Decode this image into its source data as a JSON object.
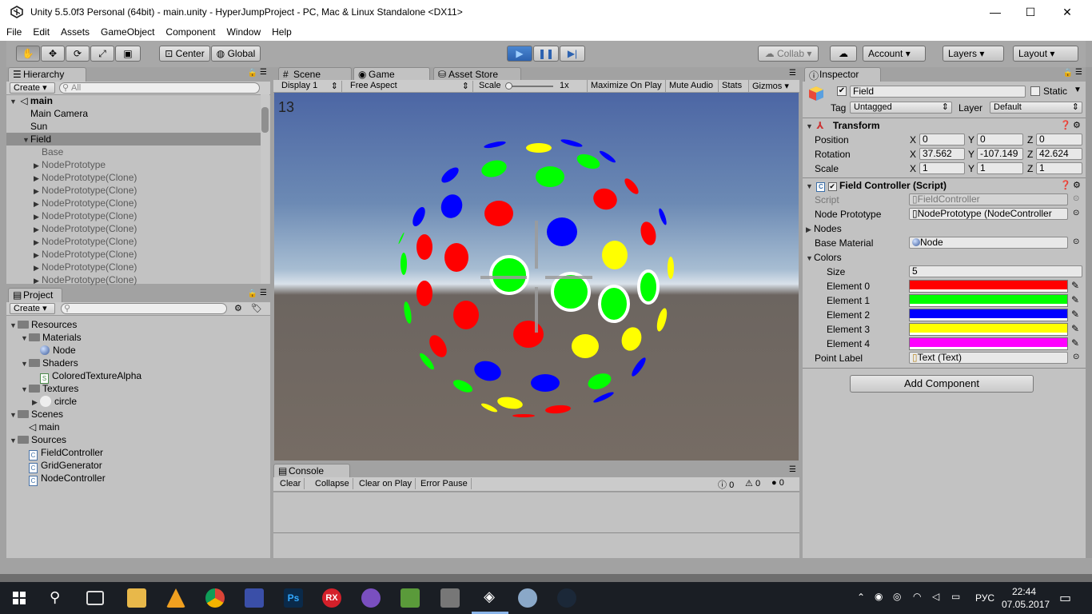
{
  "window": {
    "title": "Unity 5.5.0f3 Personal (64bit) - main.unity - HyperJumpProject - PC, Mac & Linux Standalone <DX11>",
    "minimize": "—",
    "maximize": "☐",
    "close": "✕"
  },
  "menu": [
    "File",
    "Edit",
    "Assets",
    "GameObject",
    "Component",
    "Window",
    "Help"
  ],
  "toolbar": {
    "tools": [
      "hand-icon",
      "move-icon",
      "rotate-icon",
      "scale-icon",
      "rect-icon"
    ],
    "pivot": "Center",
    "space": "Global",
    "collab": "Collab",
    "account": "Account",
    "layers": "Layers",
    "layout": "Layout"
  },
  "hierarchy": {
    "tab": "Hierarchy",
    "create": "Create",
    "search_placeholder": "All",
    "scene": "main",
    "items": [
      {
        "label": "Main Camera",
        "depth": 1
      },
      {
        "label": "Sun",
        "depth": 1
      },
      {
        "label": "Field",
        "depth": 1,
        "selected": true,
        "expanded": true
      },
      {
        "label": "Base",
        "depth": 2
      },
      {
        "label": "NodePrototype",
        "depth": 2,
        "expander": true
      },
      {
        "label": "NodePrototype(Clone)",
        "depth": 2,
        "expander": true
      },
      {
        "label": "NodePrototype(Clone)",
        "depth": 2,
        "expander": true
      },
      {
        "label": "NodePrototype(Clone)",
        "depth": 2,
        "expander": true
      },
      {
        "label": "NodePrototype(Clone)",
        "depth": 2,
        "expander": true
      },
      {
        "label": "NodePrototype(Clone)",
        "depth": 2,
        "expander": true
      },
      {
        "label": "NodePrototype(Clone)",
        "depth": 2,
        "expander": true
      },
      {
        "label": "NodePrototype(Clone)",
        "depth": 2,
        "expander": true
      },
      {
        "label": "NodePrototype(Clone)",
        "depth": 2,
        "expander": true
      },
      {
        "label": "NodePrototype(Clone)",
        "depth": 2,
        "expander": true
      }
    ]
  },
  "project": {
    "tab": "Project",
    "create": "Create",
    "tree": [
      {
        "label": "Resources",
        "depth": 0,
        "type": "folder"
      },
      {
        "label": "Materials",
        "depth": 1,
        "type": "folder"
      },
      {
        "label": "Node",
        "depth": 2,
        "type": "material"
      },
      {
        "label": "Shaders",
        "depth": 1,
        "type": "folder"
      },
      {
        "label": "ColoredTextureAlpha",
        "depth": 2,
        "type": "shader"
      },
      {
        "label": "Textures",
        "depth": 1,
        "type": "folder"
      },
      {
        "label": "circle",
        "depth": 2,
        "type": "texture"
      },
      {
        "label": "Scenes",
        "depth": 0,
        "type": "folder"
      },
      {
        "label": "main",
        "depth": 1,
        "type": "scene"
      },
      {
        "label": "Sources",
        "depth": 0,
        "type": "folder"
      },
      {
        "label": "FieldController",
        "depth": 1,
        "type": "script"
      },
      {
        "label": "GridGenerator",
        "depth": 1,
        "type": "script"
      },
      {
        "label": "NodeController",
        "depth": 1,
        "type": "script"
      }
    ]
  },
  "center_tabs": [
    "Scene",
    "Game",
    "Asset Store"
  ],
  "game_toolbar": {
    "display": "Display 1",
    "aspect": "Free Aspect",
    "scale_label": "Scale",
    "scale_value": "1x",
    "maximize": "Maximize On Play",
    "mute": "Mute Audio",
    "stats": "Stats",
    "gizmos": "Gizmos"
  },
  "game": {
    "score": "13"
  },
  "console": {
    "tab": "Console",
    "buttons": [
      "Clear",
      "Collapse",
      "Clear on Play",
      "Error Pause"
    ],
    "info_count": "0",
    "warning_count": "0",
    "error_count": "0"
  },
  "inspector": {
    "tab": "Inspector",
    "object_name": "Field",
    "static_label": "Static",
    "tag_label": "Tag",
    "tag_value": "Untagged",
    "layer_label": "Layer",
    "layer_value": "Default",
    "transform": {
      "title": "Transform",
      "position": {
        "label": "Position",
        "x": "0",
        "y": "0",
        "z": "0"
      },
      "rotation": {
        "label": "Rotation",
        "x": "37.562",
        "y": "-107.149",
        "z": "42.624"
      },
      "scale": {
        "label": "Scale",
        "x": "1",
        "y": "1",
        "z": "1"
      }
    },
    "field_controller": {
      "title": "Field Controller (Script)",
      "script_label": "Script",
      "script_value": "FieldController",
      "node_prototype_label": "Node Prototype",
      "node_prototype_value": "NodePrototype (NodeController",
      "nodes_label": "Nodes",
      "base_material_label": "Base Material",
      "base_material_value": "Node",
      "colors_label": "Colors",
      "size_label": "Size",
      "size_value": "5",
      "elements": [
        {
          "label": "Element 0",
          "color": "#ff0000"
        },
        {
          "label": "Element 1",
          "color": "#00ff00"
        },
        {
          "label": "Element 2",
          "color": "#0000ff"
        },
        {
          "label": "Element 3",
          "color": "#ffff00"
        },
        {
          "label": "Element 4",
          "color": "#ff00ff"
        }
      ],
      "point_label_label": "Point Label",
      "point_label_value": "Text (Text)"
    },
    "add_component": "Add Component"
  },
  "taskbar": {
    "lang": "РУС",
    "time": "22:44",
    "date": "07.05.2017"
  }
}
